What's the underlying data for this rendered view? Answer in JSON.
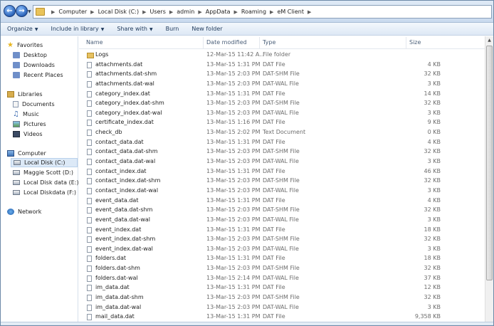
{
  "address": {
    "crumbs": [
      "Computer",
      "Local Disk (C:)",
      "Users",
      "admin",
      "AppData",
      "Roaming",
      "eM Client"
    ]
  },
  "toolbar": {
    "organize": "Organize",
    "include_in_library": "Include in library",
    "share_with": "Share with",
    "burn": "Burn",
    "new_folder": "New folder"
  },
  "nav": {
    "favorites": "Favorites",
    "desktop": "Desktop",
    "downloads": "Downloads",
    "recent_places": "Recent Places",
    "libraries": "Libraries",
    "documents": "Documents",
    "music": "Music",
    "pictures": "Pictures",
    "videos": "Videos",
    "computer": "Computer",
    "local_disk_c": "Local Disk (C:)",
    "maggie_scott_d": "Maggie Scott (D:)",
    "local_disk_data_e": "Local Disk data (E:)",
    "local_diskdata_f": "Local Diskdata (F:)",
    "network": "Network"
  },
  "columns": {
    "name": "Name",
    "date_modified": "Date modified",
    "type": "Type",
    "size": "Size"
  },
  "files": [
    {
      "name": "Logs",
      "date": "12-Mar-15 11:42 A...",
      "type": "File folder",
      "size": "",
      "folder": true
    },
    {
      "name": "attachments.dat",
      "date": "13-Mar-15 1:31 PM",
      "type": "DAT File",
      "size": "4 KB"
    },
    {
      "name": "attachments.dat-shm",
      "date": "13-Mar-15 2:03 PM",
      "type": "DAT-SHM File",
      "size": "32 KB"
    },
    {
      "name": "attachments.dat-wal",
      "date": "13-Mar-15 2:03 PM",
      "type": "DAT-WAL File",
      "size": "3 KB"
    },
    {
      "name": "category_index.dat",
      "date": "13-Mar-15 1:31 PM",
      "type": "DAT File",
      "size": "14 KB"
    },
    {
      "name": "category_index.dat-shm",
      "date": "13-Mar-15 2:03 PM",
      "type": "DAT-SHM File",
      "size": "32 KB"
    },
    {
      "name": "category_index.dat-wal",
      "date": "13-Mar-15 2:03 PM",
      "type": "DAT-WAL File",
      "size": "3 KB"
    },
    {
      "name": "certificate_index.dat",
      "date": "13-Mar-15 1:16 PM",
      "type": "DAT File",
      "size": "9 KB"
    },
    {
      "name": "check_db",
      "date": "13-Mar-15 2:02 PM",
      "type": "Text Document",
      "size": "0 KB"
    },
    {
      "name": "contact_data.dat",
      "date": "13-Mar-15 1:31 PM",
      "type": "DAT File",
      "size": "4 KB"
    },
    {
      "name": "contact_data.dat-shm",
      "date": "13-Mar-15 2:03 PM",
      "type": "DAT-SHM File",
      "size": "32 KB"
    },
    {
      "name": "contact_data.dat-wal",
      "date": "13-Mar-15 2:03 PM",
      "type": "DAT-WAL File",
      "size": "3 KB"
    },
    {
      "name": "contact_index.dat",
      "date": "13-Mar-15 1:31 PM",
      "type": "DAT File",
      "size": "46 KB"
    },
    {
      "name": "contact_index.dat-shm",
      "date": "13-Mar-15 2:03 PM",
      "type": "DAT-SHM File",
      "size": "32 KB"
    },
    {
      "name": "contact_index.dat-wal",
      "date": "13-Mar-15 2:03 PM",
      "type": "DAT-WAL File",
      "size": "3 KB"
    },
    {
      "name": "event_data.dat",
      "date": "13-Mar-15 1:31 PM",
      "type": "DAT File",
      "size": "4 KB"
    },
    {
      "name": "event_data.dat-shm",
      "date": "13-Mar-15 2:03 PM",
      "type": "DAT-SHM File",
      "size": "32 KB"
    },
    {
      "name": "event_data.dat-wal",
      "date": "13-Mar-15 2:03 PM",
      "type": "DAT-WAL File",
      "size": "3 KB"
    },
    {
      "name": "event_index.dat",
      "date": "13-Mar-15 1:31 PM",
      "type": "DAT File",
      "size": "18 KB"
    },
    {
      "name": "event_index.dat-shm",
      "date": "13-Mar-15 2:03 PM",
      "type": "DAT-SHM File",
      "size": "32 KB"
    },
    {
      "name": "event_index.dat-wal",
      "date": "13-Mar-15 2:03 PM",
      "type": "DAT-WAL File",
      "size": "3 KB"
    },
    {
      "name": "folders.dat",
      "date": "13-Mar-15 1:31 PM",
      "type": "DAT File",
      "size": "18 KB"
    },
    {
      "name": "folders.dat-shm",
      "date": "13-Mar-15 2:03 PM",
      "type": "DAT-SHM File",
      "size": "32 KB"
    },
    {
      "name": "folders.dat-wal",
      "date": "13-Mar-15 2:14 PM",
      "type": "DAT-WAL File",
      "size": "37 KB"
    },
    {
      "name": "im_data.dat",
      "date": "13-Mar-15 1:31 PM",
      "type": "DAT File",
      "size": "12 KB"
    },
    {
      "name": "im_data.dat-shm",
      "date": "13-Mar-15 2:03 PM",
      "type": "DAT-SHM File",
      "size": "32 KB"
    },
    {
      "name": "im_data.dat-wal",
      "date": "13-Mar-15 2:03 PM",
      "type": "DAT-WAL File",
      "size": "3 KB"
    },
    {
      "name": "mail_data.dat",
      "date": "13-Mar-15 1:31 PM",
      "type": "DAT File",
      "size": "9,358 KB"
    }
  ]
}
